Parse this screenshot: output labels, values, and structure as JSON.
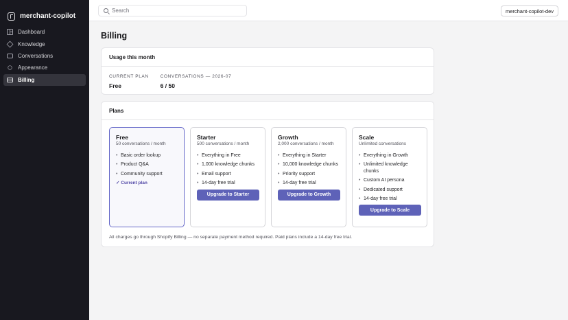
{
  "sidebar": {
    "brand": "merchant-copilot",
    "items": [
      {
        "label": "Dashboard",
        "icon": "dashboard-icon"
      },
      {
        "label": "Knowledge",
        "icon": "knowledge-icon"
      },
      {
        "label": "Conversations",
        "icon": "conversations-icon"
      },
      {
        "label": "Appearance",
        "icon": "appearance-icon"
      },
      {
        "label": "Billing",
        "icon": "billing-icon",
        "active": true
      }
    ]
  },
  "topbar": {
    "search_placeholder": "Search",
    "workspace": "merchant-copilot-dev"
  },
  "page": {
    "title": "Billing"
  },
  "usage": {
    "title": "Usage this month",
    "current_plan_label": "CURRENT PLAN",
    "current_plan_value": "Free",
    "conversations_label": "CONVERSATIONS — 2026-07",
    "conversations_value": "6 / 50"
  },
  "plans": {
    "title": "Plans",
    "items": [
      {
        "name": "Free",
        "subtitle": "50 conversations / month",
        "features": [
          "Basic order lookup",
          "Product Q&A",
          "Community support"
        ],
        "current_label": "✓ Current plan"
      },
      {
        "name": "Starter",
        "subtitle": "500 conversations / month",
        "features": [
          "Everything in Free",
          "1,000 knowledge chunks",
          "Email support",
          "14-day free trial"
        ],
        "button": "Upgrade to Starter"
      },
      {
        "name": "Growth",
        "subtitle": "2,000 conversations / month",
        "features": [
          "Everything in Starter",
          "10,000 knowledge chunks",
          "Priority support",
          "14-day free trial"
        ],
        "button": "Upgrade to Growth"
      },
      {
        "name": "Scale",
        "subtitle": "Unlimited conversations",
        "features": [
          "Everything in Growth",
          "Unlimited knowledge chunks",
          "Custom AI persona",
          "Dedicated support",
          "14-day free trial"
        ],
        "button": "Upgrade to Scale"
      }
    ],
    "footnote": "All charges go through Shopify Billing — no separate payment method required. Paid plans include a 14-day free trial."
  },
  "colors": {
    "sidebar_bg": "#18181f",
    "accent": "#5e62b8",
    "current_border": "#6467c8"
  }
}
